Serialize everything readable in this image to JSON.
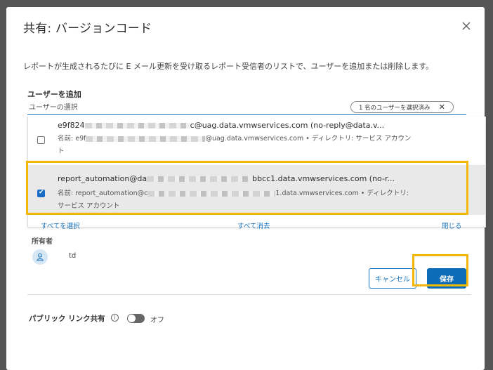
{
  "dialog": {
    "title": "共有: バージョンコード",
    "description": "レポートが生成されるたびに E メール更新を受け取るレポート受信者のリストで、ユーザーを追加または削除します。"
  },
  "add_user": {
    "label": "ユーザーを追加",
    "placeholder": "ユーザーの選択",
    "selected_chip": "1 名のユーザーを選択済み"
  },
  "user_list": [
    {
      "email_start": "e9f824",
      "email_end": "c@uag.data.vmwservices.com (no-reply@data.v...",
      "name_prefix": "名前: e9f",
      "name_suffix": "@uag.data.vmwservices.com • ディレクトリ: サービス アカウント",
      "checked": false
    },
    {
      "email_start": "report_automation@da",
      "email_end": "bbcc1.data.vmwservices.com (no-r...",
      "name_prefix": "名前: report_automation@c",
      "name_suffix": "1.data.vmwservices.com • ディレクトリ: サービス アカウント",
      "checked": true
    }
  ],
  "dropdown_footer": {
    "select_all": "すべてを選択",
    "clear_all": "すべて消去",
    "close": "閉じる"
  },
  "owner": {
    "label": "所有者",
    "name": "td"
  },
  "buttons": {
    "cancel": "キャンセル",
    "save": "保存"
  },
  "public_link": {
    "label": "パブリック リンク共有",
    "state": "オフ"
  },
  "colors": {
    "accent": "#1b74bb",
    "highlight": "#f2b705"
  }
}
